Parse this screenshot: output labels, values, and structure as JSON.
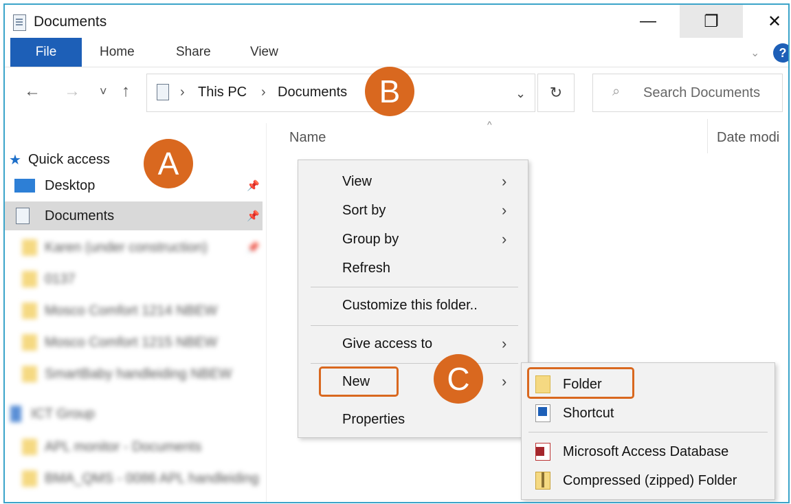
{
  "window": {
    "title": "Documents",
    "controls": {
      "minimize": "—",
      "maximize": "❐",
      "close": "✕"
    }
  },
  "ribbon": {
    "tabs": [
      "File",
      "Home",
      "Share",
      "View"
    ],
    "help": "?"
  },
  "nav": {
    "back": "←",
    "forward": "→",
    "recent": "˅",
    "up": "↑",
    "breadcrumb": [
      "This PC",
      "Documents"
    ],
    "separator": "›",
    "refresh": "↻",
    "search_placeholder": "Search Documents"
  },
  "sidebar": {
    "quick_access": "Quick access",
    "items": [
      {
        "label": "Desktop",
        "pinned": true
      },
      {
        "label": "Documents",
        "pinned": true,
        "selected": true
      },
      {
        "label": "Karen (under construction)",
        "pinned": true
      },
      {
        "label": "0137"
      },
      {
        "label": "Mosco Comfort 1214 NBEW"
      },
      {
        "label": "Mosco Comfort 1215 NBEW"
      },
      {
        "label": "SmartBaby handleiding NBEW"
      },
      {
        "label": "ICT Group"
      },
      {
        "label": "APL monitor - Documents"
      },
      {
        "label": "BMA_QMS - 0086 APL handleiding"
      }
    ]
  },
  "columns": {
    "name": "Name",
    "date": "Date modi"
  },
  "context_menu": {
    "items": [
      "View",
      "Sort by",
      "Group by",
      "Refresh",
      "Customize this folder..",
      "Give access to",
      "New",
      "Properties"
    ]
  },
  "submenu": {
    "items": [
      "Folder",
      "Shortcut",
      "Microsoft Access Database",
      "Compressed (zipped) Folder"
    ]
  },
  "callouts": {
    "a": "A",
    "b": "B",
    "c": "C"
  },
  "colors": {
    "accent": "#d9681f",
    "file_tab": "#1d5fb7",
    "frame": "#3aa3c9"
  }
}
